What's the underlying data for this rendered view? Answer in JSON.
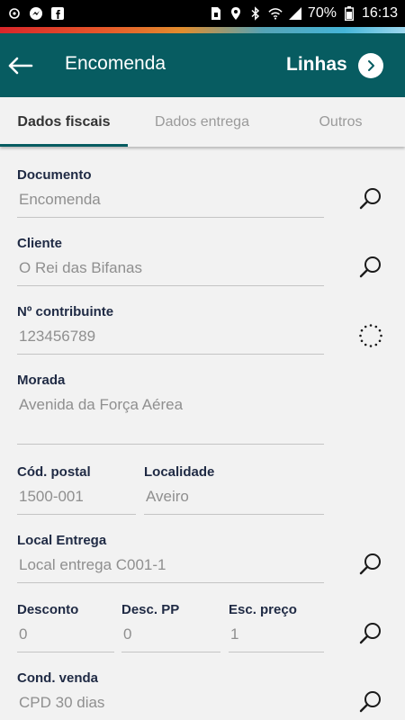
{
  "status_bar": {
    "battery": "70%",
    "time": "16:13",
    "left_icons": [
      "sync-icon",
      "messenger-icon",
      "facebook-icon"
    ],
    "right_icons": [
      "sim-icon",
      "location-icon",
      "bluetooth-icon",
      "wifi-icon",
      "signal-icon",
      "battery-icon"
    ]
  },
  "app_bar": {
    "title": "Encomenda",
    "right_label": "Linhas",
    "back_icon": "back-arrow-icon",
    "next_icon": "chevron-right-icon",
    "color": "#075c61"
  },
  "tabs": [
    {
      "label": "Dados fiscais",
      "active": true
    },
    {
      "label": "Dados entrega",
      "active": false
    },
    {
      "label": "Outros",
      "active": false
    }
  ],
  "form": {
    "documento": {
      "label": "Documento",
      "value": "Encomenda"
    },
    "cliente": {
      "label": "Cliente",
      "value": "O Rei das Bifanas"
    },
    "contribuinte": {
      "label": "Nº contribuinte",
      "value": "123456789"
    },
    "morada": {
      "label": "Morada",
      "value": "Avenida da Força Aérea"
    },
    "cod_postal": {
      "label": "Cód. postal",
      "value": "1500-001"
    },
    "localidade": {
      "label": "Localidade",
      "value": "Aveiro"
    },
    "local_entrega": {
      "label": "Local Entrega",
      "value": "Local entrega C001-1"
    },
    "desconto": {
      "label": "Desconto",
      "value": "0"
    },
    "desc_pp": {
      "label": "Desc. PP",
      "value": "0"
    },
    "esc_preco": {
      "label": "Esc. preço",
      "value": "1"
    },
    "cond_venda": {
      "label": "Cond. venda",
      "value": "CPD 30 dias"
    }
  }
}
